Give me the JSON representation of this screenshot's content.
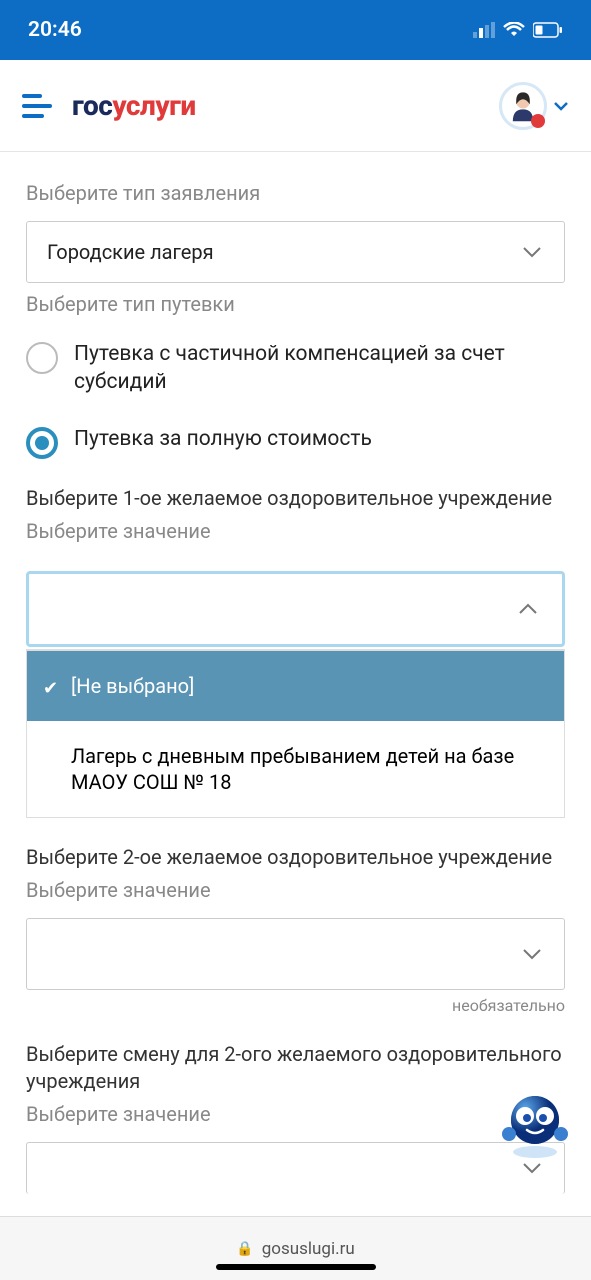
{
  "status": {
    "time": "20:46"
  },
  "logo": {
    "gos": "гос",
    "uslugi": "услуги"
  },
  "form": {
    "app_type_label": "Выберите тип заявления",
    "app_type_value": "Городские лагеря",
    "voucher_label": "Выберите тип путевки",
    "radio1": "Путевка с частичной компенсацией за счет субсидий",
    "radio2": "Путевка за полную стоимость",
    "inst1_label": "Выберите 1-ое желаемое оздоровительное учреждение",
    "select_placeholder": "Выберите значение",
    "dropdown": {
      "opt_none": "[Не выбрано]",
      "opt1": "Лагерь с дневным пребыванием детей на базе МАОУ СОШ № 18"
    },
    "inst2_label": "Выберите 2-ое желаемое оздоровительное учреждение",
    "optional": "необязательно",
    "shift2_label": "Выберите смену для 2-ого желаемого оздоровительного учреждения"
  },
  "footer": {
    "url": "gosuslugi.ru"
  }
}
